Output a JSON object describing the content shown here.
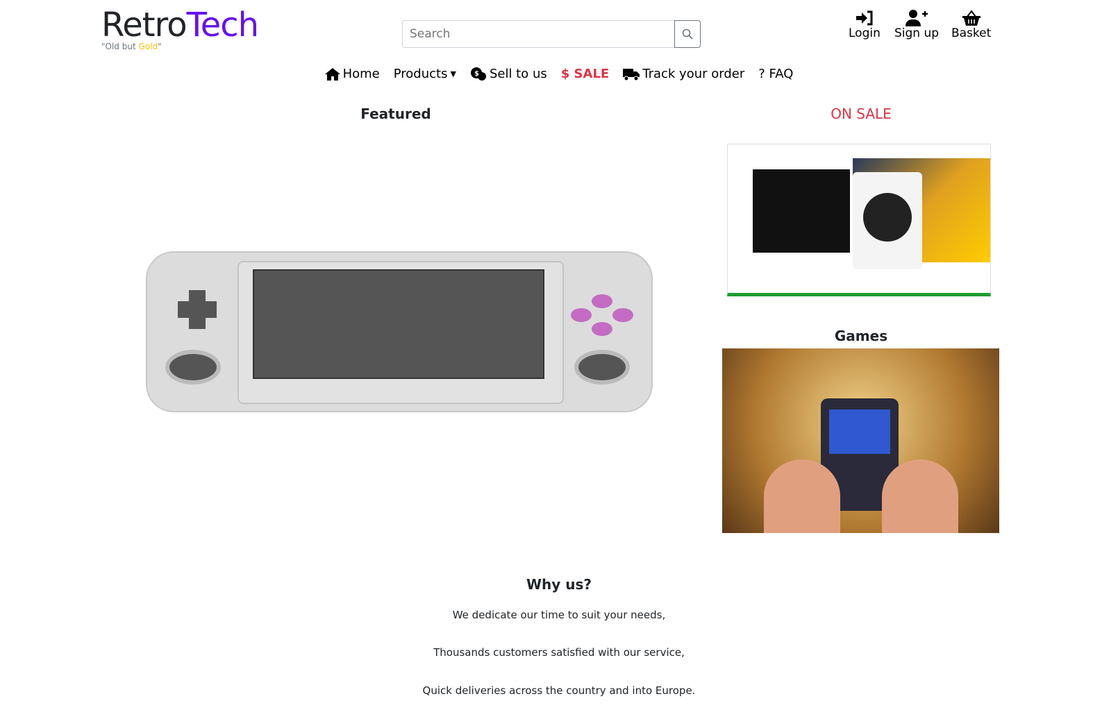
{
  "header": {
    "logo_part1": "Retro",
    "logo_part2": "Tech",
    "tagline_prefix": "\"Old but ",
    "tagline_gold": "Gold",
    "tagline_suffix": "\"",
    "search_placeholder": "Search",
    "login": "Login",
    "signup": "Sign up",
    "basket": "Basket"
  },
  "nav": {
    "home": "Home",
    "products": "Products",
    "sell": "Sell to us",
    "sale": "$ SALE",
    "track": "Track your order",
    "faq": "? FAQ"
  },
  "main": {
    "featured": "Featured",
    "on_sale": "ON SALE",
    "games": "Games"
  },
  "why": {
    "title": "Why us?",
    "lines": [
      "We dedicate our time to suit your needs,",
      "Thousands customers satisfied with our service,",
      "Quick deliveries across the country and into Europe."
    ]
  },
  "colors": {
    "brand": "#6610f2",
    "sale": "#dc3545",
    "gold": "#ffc107"
  }
}
